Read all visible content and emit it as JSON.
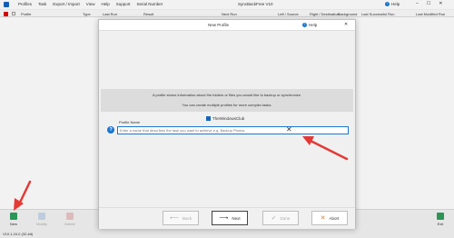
{
  "window": {
    "title": "SyncBackFree V10",
    "help": "Help",
    "menu": [
      "Profiles",
      "Task",
      "Export / Import",
      "View",
      "Help",
      "Support",
      "Serial Number"
    ]
  },
  "columns": [
    "Profile",
    "Type",
    "Last Run",
    "Result",
    "Next Run",
    "Left / Source",
    "Right / Destination",
    "Background",
    "Last Successful Run",
    "Last Modified Run"
  ],
  "toolbar": {
    "new_label": "New",
    "modify_label": "Modify",
    "delete_label": "Delete",
    "exit_label": "Exit"
  },
  "status": "V10.1.24.0 (32-bit)",
  "dialog": {
    "title": "New Profile",
    "help": "Help",
    "info_line1": "A profile stores information about the folders or files you would like to backup or synchronize.",
    "info_line2": "You can create multiple profiles for more complex tasks.",
    "watermark": "TheWindowsClub",
    "profile_name_label": "Profile Name",
    "profile_name_placeholder": "Enter a name that describes the task you want to achieve e.g. Backup Photos",
    "back_label": "Back",
    "next_label": "Next",
    "done_label": "Done",
    "abort_label": "Abort"
  },
  "colors": {
    "accent": "#1976d2",
    "arrow": "#e53935",
    "abort_icon": "#e67e22"
  }
}
